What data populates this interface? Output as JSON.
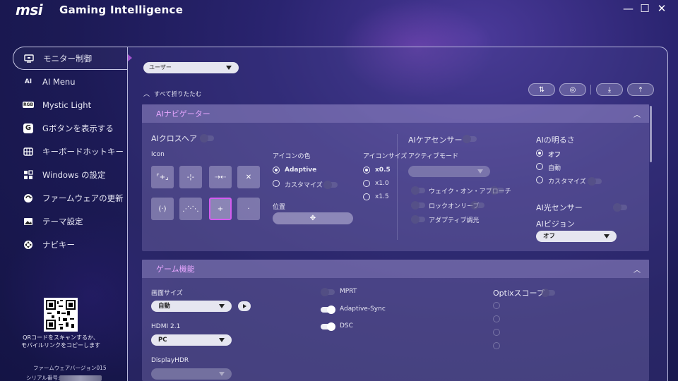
{
  "app": {
    "logo": "msi",
    "title": "Gaming Intelligence"
  },
  "window": {
    "minimize": "—",
    "maximize": "☐",
    "close": "✕"
  },
  "sidebar": {
    "items": [
      {
        "label": "モニター制御",
        "icon": "monitor-icon",
        "active": true
      },
      {
        "label": "AI Menu",
        "icon": "ai-icon"
      },
      {
        "label": "Mystic Light",
        "icon": "rgb-icon"
      },
      {
        "label": "Gボタンを表示する",
        "icon": "g-button-icon"
      },
      {
        "label": "キーボードホットキー",
        "icon": "keyboard-icon"
      },
      {
        "label": "Windows の設定",
        "icon": "windows-icon"
      },
      {
        "label": "ファームウェアの更新",
        "icon": "firmware-icon"
      },
      {
        "label": "テーマ設定",
        "icon": "theme-icon"
      },
      {
        "label": "ナビキー",
        "icon": "navi-key-icon"
      }
    ],
    "qr_text": "QRコードをスキャンするか、モバイルリンクをコピーします",
    "firmware": "ファームウェアバージョン015",
    "serial_label": "シリアル番号:"
  },
  "main": {
    "user_dropdown": "ユーザー",
    "collapse_all": "すべて折りたたむ",
    "ai_navigator": {
      "title": "AIナビゲーター",
      "crosshair": "AIクロスヘア",
      "icon_label": "Icon",
      "icon_color": "アイコンの色",
      "color_options": [
        "Adaptive",
        "カスタマイズ"
      ],
      "icon_size": "アイコンサイズ",
      "size_options": [
        "x0.5",
        "x1.0",
        "x1.5"
      ],
      "position": "位置",
      "care_sensor": "AIケアセンサー",
      "active_mode": "アクティブモード",
      "care_options": [
        "ウェイク・オン・アプローチ",
        "ロックオンリーブ",
        "アダプティブ調光"
      ],
      "brightness": "AIの明るさ",
      "brightness_options": [
        "オフ",
        "自動",
        "カスタマイズ"
      ],
      "light_sensor": "AI光センサー",
      "vision": "AIビジョン",
      "vision_value": "オフ"
    },
    "gaming": {
      "title": "ゲーム機能",
      "screen_size": "画面サイズ",
      "screen_size_value": "自動",
      "hdmi": "HDMI 2.1",
      "hdmi_value": "PC",
      "displayhdr": "DisplayHDR",
      "mprt": "MPRT",
      "adaptive_sync": "Adaptive-Sync",
      "dsc": "DSC",
      "optix": "Optixスコープ"
    }
  },
  "colors": {
    "accent": "#d35cf0",
    "section_title": "#e7a6ff"
  }
}
